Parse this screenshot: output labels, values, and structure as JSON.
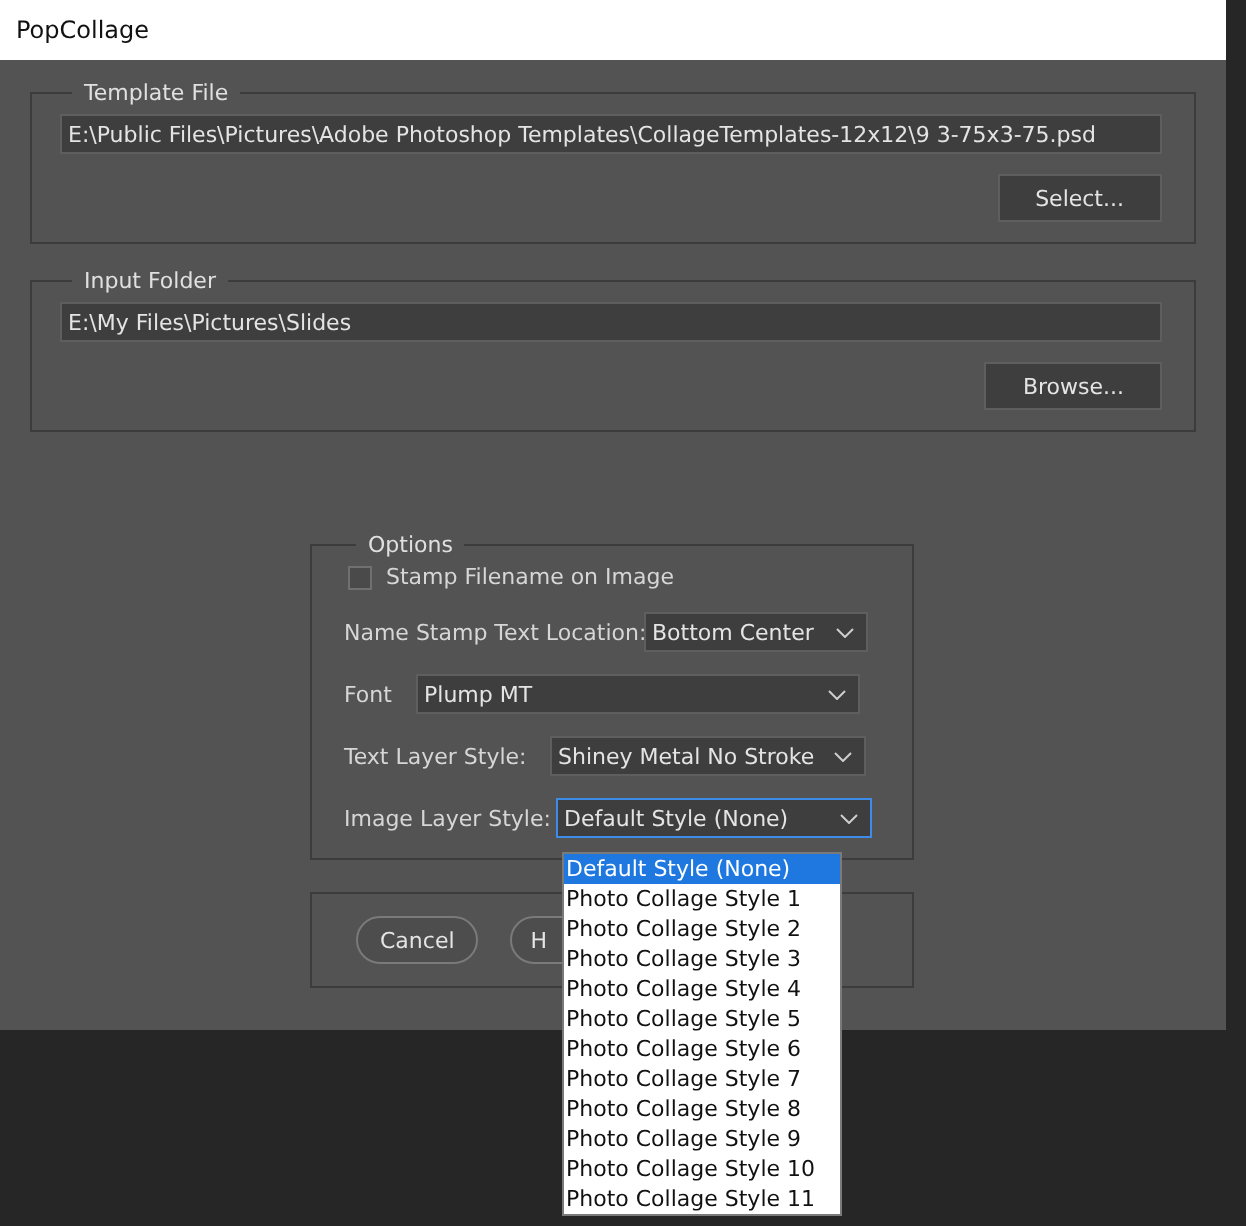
{
  "window": {
    "title": "PopCollage"
  },
  "template_file": {
    "legend": "Template File",
    "value": "E:\\Public Files\\Pictures\\Adobe Photoshop Templates\\CollageTemplates-12x12\\9 3-75x3-75.psd",
    "button": "Select..."
  },
  "input_folder": {
    "legend": "Input Folder",
    "value": "E:\\My Files\\Pictures\\Slides",
    "button": "Browse..."
  },
  "options": {
    "legend": "Options",
    "stamp": {
      "label": "Stamp Filename on Image",
      "checked": false
    },
    "fields": [
      {
        "label": "Name Stamp Text  Location:",
        "value": "Bottom Center",
        "focused": false
      },
      {
        "label": "Font",
        "value": "Plump MT",
        "focused": false
      },
      {
        "label": "Text Layer Style:",
        "value": "Shiney Metal No Stroke",
        "focused": false
      },
      {
        "label": "Image Layer Style:",
        "value": "Default Style (None)",
        "focused": true
      }
    ]
  },
  "dropdown_list": [
    {
      "label": "Default Style (None)",
      "selected": true
    },
    {
      "label": "Photo Collage Style 1",
      "selected": false
    },
    {
      "label": "Photo Collage Style 2",
      "selected": false
    },
    {
      "label": "Photo Collage Style 3",
      "selected": false
    },
    {
      "label": "Photo Collage Style 4",
      "selected": false
    },
    {
      "label": "Photo Collage Style 5",
      "selected": false
    },
    {
      "label": "Photo Collage Style 6",
      "selected": false
    },
    {
      "label": "Photo Collage Style 7",
      "selected": false
    },
    {
      "label": "Photo Collage Style 8",
      "selected": false
    },
    {
      "label": "Photo Collage Style 9",
      "selected": false
    },
    {
      "label": "Photo Collage Style 10",
      "selected": false
    },
    {
      "label": "Photo Collage Style 11",
      "selected": false
    }
  ],
  "buttons": [
    "Cancel",
    "H"
  ]
}
